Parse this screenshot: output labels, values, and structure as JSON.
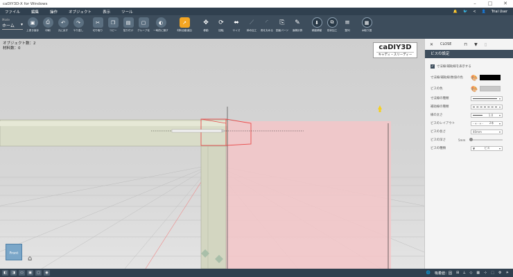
{
  "window": {
    "title": "caDIY3D-X for Windows"
  },
  "menu": [
    "ファイル",
    "編集",
    "操作",
    "オブジェクト",
    "表示",
    "ツール"
  ],
  "user": {
    "name": "Trial User"
  },
  "mode": {
    "label": "Mode",
    "value": "ホーム"
  },
  "toolbar": [
    {
      "label": "上書き保存",
      "icon": "save-icon",
      "glyph": "▣"
    },
    {
      "label": "印刷",
      "icon": "print-icon",
      "glyph": "⎙"
    },
    {
      "label": "元に戻す",
      "icon": "undo-icon",
      "glyph": "↶"
    },
    {
      "label": "やり直し",
      "icon": "redo-icon",
      "glyph": "↷"
    },
    {
      "label": "切り取り",
      "icon": "cut-icon",
      "glyph": "✂"
    },
    {
      "label": "コピー",
      "icon": "copy-icon",
      "glyph": "❐"
    },
    {
      "label": "貼り付け",
      "icon": "paste-icon",
      "glyph": "▤"
    },
    {
      "label": "グループ化",
      "icon": "group-icon",
      "glyph": "▢"
    },
    {
      "label": "一時的に隠す",
      "icon": "hide-icon",
      "glyph": "◐"
    },
    {
      "label": "材料自動追加",
      "icon": "material-add-icon",
      "glyph": "↗"
    },
    {
      "label": "移動",
      "icon": "move-icon",
      "glyph": "✥"
    },
    {
      "label": "回転",
      "icon": "rotate-icon",
      "glyph": "⟳"
    },
    {
      "label": "サイズ",
      "icon": "size-icon",
      "glyph": "⬌"
    },
    {
      "label": "斜め加工",
      "icon": "diagonal-cut-icon",
      "glyph": "⟋"
    },
    {
      "label": "角を丸める",
      "icon": "round-corner-icon",
      "glyph": "◜"
    },
    {
      "label": "図面パーツ",
      "icon": "drawing-parts-icon",
      "glyph": "⎘"
    },
    {
      "label": "面積計算",
      "icon": "area-calc-icon",
      "glyph": "✎"
    },
    {
      "label": "精度移動",
      "icon": "precise-move-icon",
      "glyph": "⬇"
    },
    {
      "label": "形状加工",
      "icon": "shape-process-icon",
      "glyph": "⧉"
    },
    {
      "label": "整列",
      "icon": "align-icon",
      "glyph": "≡"
    },
    {
      "label": "木取り図",
      "icon": "cut-plan-icon",
      "glyph": "▦"
    }
  ],
  "viewport": {
    "object_count": "オブジェクト数：2",
    "material_count": "材料数：0",
    "logo_main": "caDIY3D",
    "logo_sub": "キャディ・スリーディー",
    "view_label": "Front"
  },
  "panel": {
    "close": "CLOSE",
    "title": "ビスの設定",
    "show_dim_checkbox": "寸法線/補助線を表示する",
    "rows": [
      {
        "label": "寸法線/補助線/数値の色"
      },
      {
        "label": "ビスの色"
      },
      {
        "label": "寸法線の種類"
      },
      {
        "label": "補助線の種類"
      },
      {
        "label": "線の太さ",
        "value": "1.0"
      },
      {
        "label": "ビスのレイアウト",
        "value": "2本"
      },
      {
        "label": "ビスの長さ",
        "value": "40mm"
      },
      {
        "label": "ビスの深さ",
        "value": "5mm"
      },
      {
        "label": "ビスの種類",
        "value": "ビス"
      }
    ]
  },
  "status": {
    "snap_label": "吸着値：固"
  },
  "colors": {
    "accent": "#3d4d5c",
    "menu_bg": "#30404f",
    "highlight": "#f5a623",
    "selection": "#e84c4c"
  }
}
